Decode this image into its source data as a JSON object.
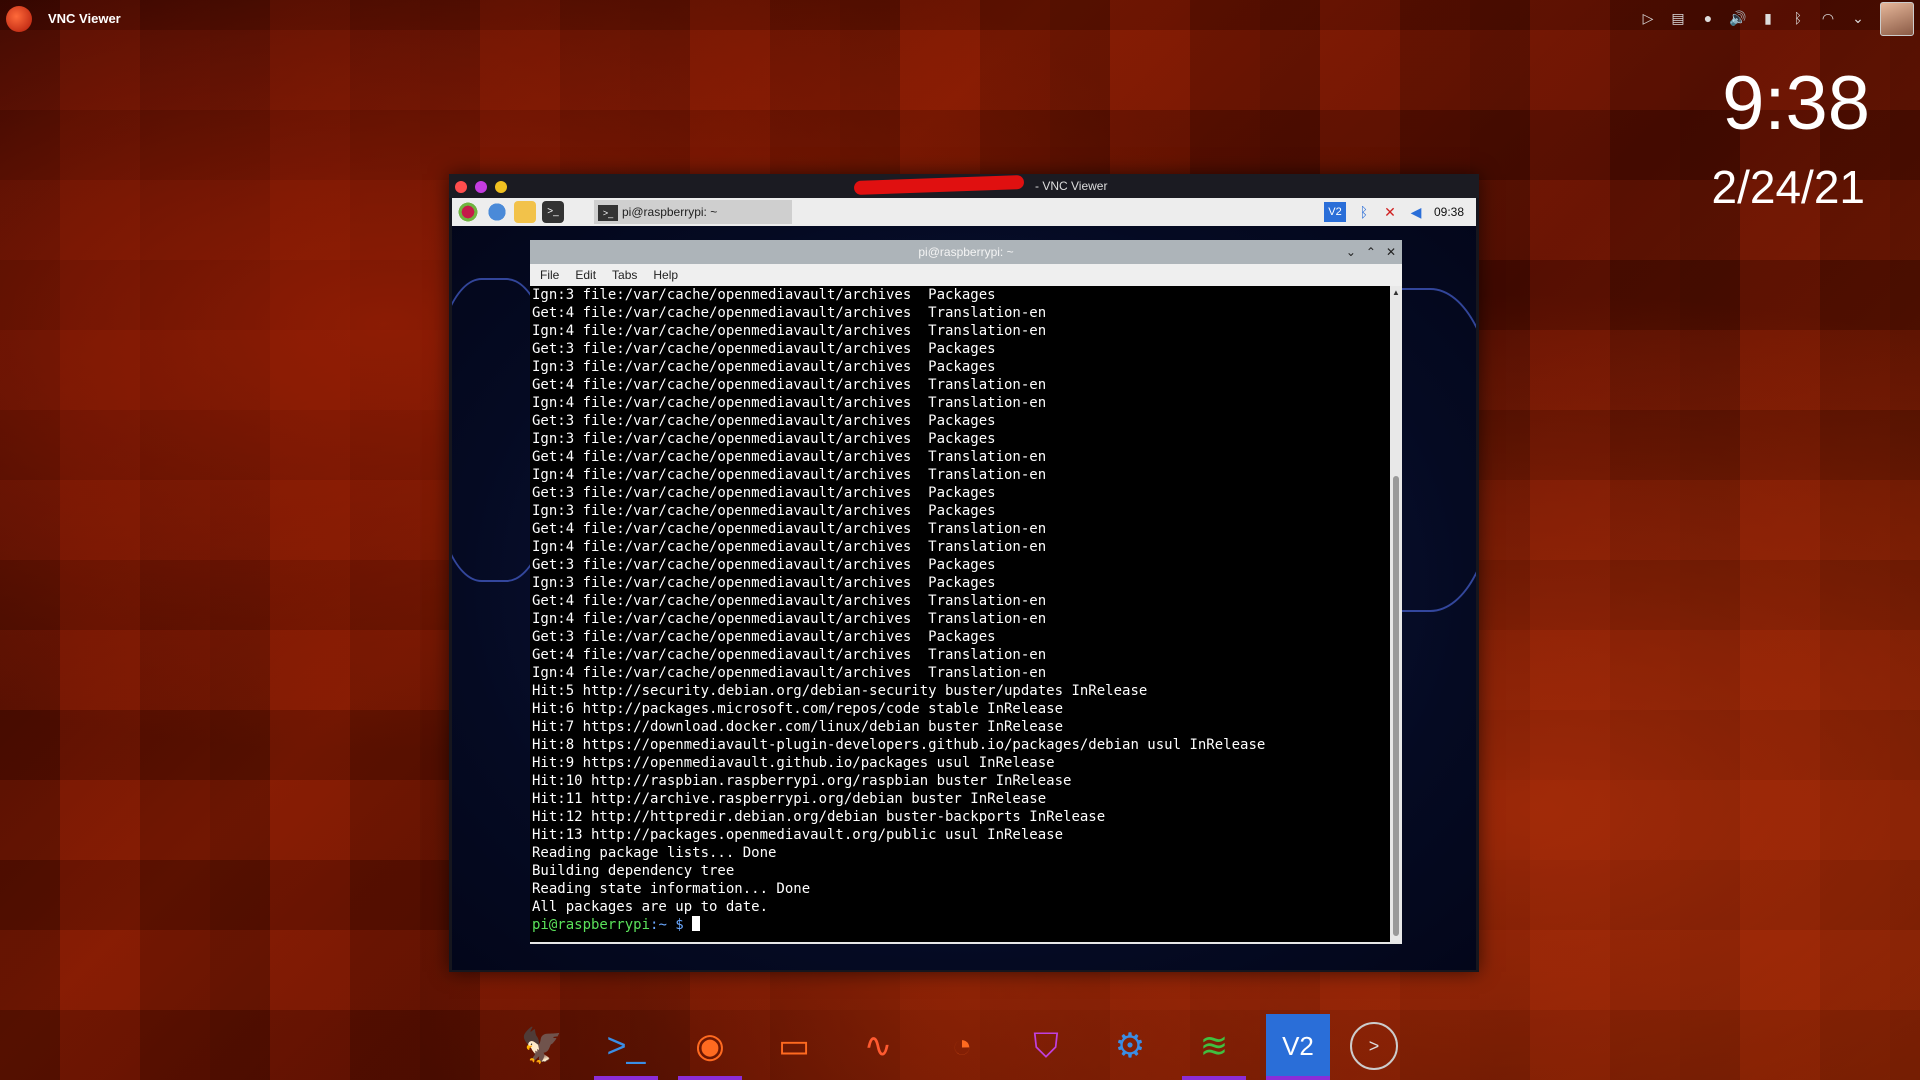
{
  "topbar": {
    "app_title": "VNC Viewer",
    "tray_icons": [
      "media-icon",
      "clipboard-icon",
      "notification-icon",
      "volume-icon",
      "battery-icon",
      "bluetooth-icon",
      "network-icon",
      "chevron-down-icon"
    ]
  },
  "desktop": {
    "clock": "9:38",
    "date": "2/24/21"
  },
  "vnc": {
    "title": "- VNC Viewer",
    "panel": {
      "task_label": "pi@raspberrypi: ~",
      "vnc_icon_label": "V2",
      "time": "09:38"
    }
  },
  "terminal": {
    "title": "pi@raspberrypi: ~",
    "menu": [
      "File",
      "Edit",
      "Tabs",
      "Help"
    ],
    "lines": [
      "Ign:3 file:/var/cache/openmediavault/archives  Packages",
      "Get:4 file:/var/cache/openmediavault/archives  Translation-en",
      "Ign:4 file:/var/cache/openmediavault/archives  Translation-en",
      "Get:3 file:/var/cache/openmediavault/archives  Packages",
      "Ign:3 file:/var/cache/openmediavault/archives  Packages",
      "Get:4 file:/var/cache/openmediavault/archives  Translation-en",
      "Ign:4 file:/var/cache/openmediavault/archives  Translation-en",
      "Get:3 file:/var/cache/openmediavault/archives  Packages",
      "Ign:3 file:/var/cache/openmediavault/archives  Packages",
      "Get:4 file:/var/cache/openmediavault/archives  Translation-en",
      "Ign:4 file:/var/cache/openmediavault/archives  Translation-en",
      "Get:3 file:/var/cache/openmediavault/archives  Packages",
      "Ign:3 file:/var/cache/openmediavault/archives  Packages",
      "Get:4 file:/var/cache/openmediavault/archives  Translation-en",
      "Ign:4 file:/var/cache/openmediavault/archives  Translation-en",
      "Get:3 file:/var/cache/openmediavault/archives  Packages",
      "Ign:3 file:/var/cache/openmediavault/archives  Packages",
      "Get:4 file:/var/cache/openmediavault/archives  Translation-en",
      "Ign:4 file:/var/cache/openmediavault/archives  Translation-en",
      "Get:3 file:/var/cache/openmediavault/archives  Packages",
      "Get:4 file:/var/cache/openmediavault/archives  Translation-en",
      "Ign:4 file:/var/cache/openmediavault/archives  Translation-en",
      "Hit:5 http://security.debian.org/debian-security buster/updates InRelease",
      "Hit:6 http://packages.microsoft.com/repos/code stable InRelease",
      "Hit:7 https://download.docker.com/linux/debian buster InRelease",
      "Hit:8 https://openmediavault-plugin-developers.github.io/packages/debian usul InRelease",
      "Hit:9 https://openmediavault.github.io/packages usul InRelease",
      "Hit:10 http://raspbian.raspberrypi.org/raspbian buster InRelease",
      "Hit:11 http://archive.raspberrypi.org/debian buster InRelease",
      "Hit:12 http://httpredir.debian.org/debian buster-backports InRelease",
      "Hit:13 http://packages.openmediavault.org/public usul InRelease",
      "Reading package lists... Done",
      "Building dependency tree",
      "Reading state information... Done",
      "All packages are up to date."
    ],
    "prompt_user": "pi@raspberrypi",
    "prompt_rest": ":~ $ "
  },
  "dock": {
    "items": [
      {
        "name": "eagle-app-icon",
        "glyph": "🦅"
      },
      {
        "name": "terminal-icon",
        "glyph": ">_"
      },
      {
        "name": "firefox-icon",
        "glyph": "◉"
      },
      {
        "name": "folder-icon",
        "glyph": "▭"
      },
      {
        "name": "system-monitor-icon",
        "glyph": "∿"
      },
      {
        "name": "disk-usage-icon",
        "glyph": "◔"
      },
      {
        "name": "store-icon",
        "glyph": "⛉"
      },
      {
        "name": "settings-gear-icon",
        "glyph": "⚙"
      },
      {
        "name": "spotify-icon",
        "glyph": "≋"
      },
      {
        "name": "vnc-viewer-icon",
        "glyph": "V2"
      },
      {
        "name": "show-more-icon",
        "glyph": ">"
      }
    ]
  }
}
